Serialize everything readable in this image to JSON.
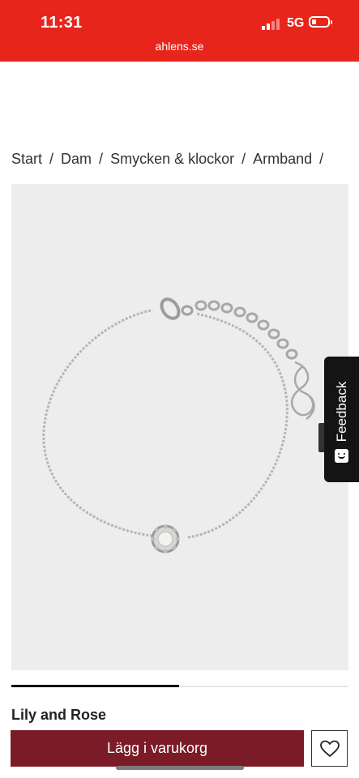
{
  "status_bar": {
    "time": "11:31",
    "network": "5G"
  },
  "browser": {
    "url": "ahlens.se"
  },
  "breadcrumb": {
    "items": [
      "Start",
      "Dam",
      "Smycken & klockor",
      "Armband"
    ],
    "separator": "/"
  },
  "feedback_tab": {
    "label": "Feedback"
  },
  "product": {
    "brand": "Lily and Rose"
  },
  "actions": {
    "add_to_cart_label": "Lägg i varukorg"
  },
  "colors": {
    "header": "#e8251b",
    "cta": "#7a1b27",
    "image_bg": "#ededed"
  },
  "icons": {
    "favorite": "heart-outline-icon",
    "feedback": "smiley-icon"
  }
}
